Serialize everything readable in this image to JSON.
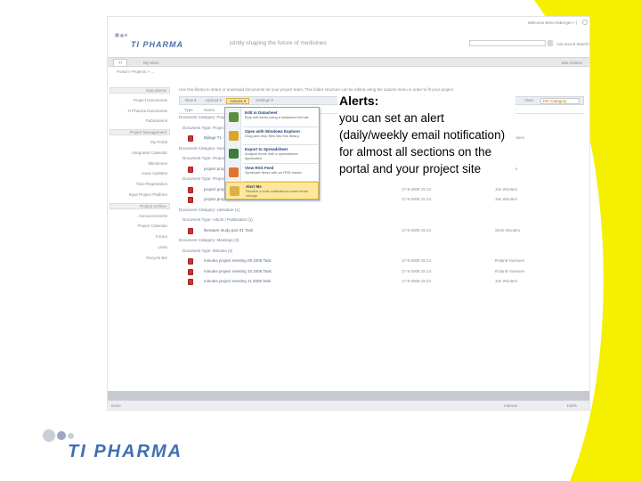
{
  "slide": {
    "callout_title": "Alerts:",
    "callout_body": "you can set an alert (daily/weekly email notification) for almost all sections on the portal and your project site",
    "logo_text": "TI PHARMA",
    "accent_color": "#f5f000",
    "brand_color": "#3f6fb1"
  },
  "screenshot": {
    "welcome": "Welcome Bets Alsbergen • |",
    "logo_text": "TI PHARMA",
    "tagline": "jointly shaping the future of medicines",
    "advanced_search": "Adv anced Search",
    "nav_tab_home": "TI",
    "nav_tab_mysites": "My Sites",
    "site_actions": "Site Actions",
    "breadcrumb": "Portal > Projects > ...",
    "left_nav": [
      {
        "label": "Documents",
        "boxed": true
      },
      {
        "label": "Project Documents",
        "boxed": false
      },
      {
        "label": "TI Pharma Documents",
        "boxed": false
      },
      {
        "label": "Publications",
        "boxed": false
      },
      {
        "label": "Project Management",
        "boxed": true
      },
      {
        "label": "My Portal",
        "boxed": false
      },
      {
        "label": "Integrated Calendar",
        "boxed": false
      },
      {
        "label": "Milestones",
        "boxed": false
      },
      {
        "label": "Issue Updates",
        "boxed": false
      },
      {
        "label": "Time Registration",
        "boxed": false
      },
      {
        "label": "Input Project Platform",
        "boxed": false
      },
      {
        "label": "Project Archive",
        "boxed": true
      },
      {
        "label": "Announcements",
        "boxed": false
      },
      {
        "label": "Project Calendar",
        "boxed": false
      },
      {
        "label": "Forum",
        "boxed": false
      },
      {
        "label": "Links",
        "boxed": false
      },
      {
        "label": "Recycle Bin",
        "boxed": false
      }
    ],
    "description": "Use this library to share or download documents for your project team. This folder structure can be edited using the actions menu in order to fit your project",
    "toolbar": {
      "new": "New ▾",
      "upload": "Upload ▾",
      "actions": "Actions ▾",
      "settings": "Settings ▾",
      "view_label": "View:",
      "view_value": "Per Category"
    },
    "columns": {
      "type": "Type",
      "name": "Name",
      "modified": "Modified",
      "modified_by": "Modified By"
    },
    "rows": [
      {
        "kind": "group",
        "label": "Document Category: Project (1)"
      },
      {
        "kind": "group",
        "label": "Document Type: Project (1)"
      },
      {
        "kind": "doc",
        "name": "Bijlage T1 - TI ...",
        "date": "",
        "who": "Roland Hoessen"
      },
      {
        "kind": "group",
        "label": "Document Category: General (2)"
      },
      {
        "kind": "group",
        "label": "Document Type: Proposal (1)"
      },
      {
        "kind": "doc",
        "name": "project proposal ... 2008 Task",
        "date": "17-9-2008 15:13",
        "who": "Jan Wouters"
      },
      {
        "kind": "group",
        "label": "Document Type: Proposal (1)"
      },
      {
        "kind": "doc",
        "name": "project proposal final doc ... 2008 Task",
        "date": "17-9-2008 15:13",
        "who": "Jan Wouters"
      },
      {
        "kind": "doc",
        "name": "project proposal final draft 2008 Task",
        "date": "17-9-2008 15:13",
        "who": "Jan Wouters"
      },
      {
        "kind": "group",
        "label": "Document Category: Literature (1)"
      },
      {
        "kind": "group",
        "label": "Document Type: Article / Publication (1)"
      },
      {
        "kind": "doc",
        "name": "literature study part 01 Task",
        "date": "17-9-2008 15:13",
        "who": "Stein Wouters"
      },
      {
        "kind": "group",
        "label": "Document Category: Meetings (3)"
      },
      {
        "kind": "group",
        "label": "Document Type: Minutes (3)"
      },
      {
        "kind": "doc",
        "name": "minutes project meeting 09 2008 Task",
        "date": "17-9-2008 15:14",
        "who": "Roland Hoessen"
      },
      {
        "kind": "doc",
        "name": "minutes project meeting 10 2008 Task",
        "date": "17-9-2008 15:14",
        "who": "Roland Hoessen"
      },
      {
        "kind": "doc",
        "name": "minutes project meeting 11 2008 Task",
        "date": "17-9-2008 15:23",
        "who": "Jan Wouters"
      }
    ],
    "actions_menu": [
      {
        "title": "Edit in Datasheet",
        "desc": "Bulk edit items using a datasheet format.",
        "color": "#5b8f3f",
        "highlight": false
      },
      {
        "title": "Open with Windows Explorer",
        "desc": "Drag and drop files into this library.",
        "color": "#d9a629",
        "highlight": false
      },
      {
        "title": "Export to Spreadsheet",
        "desc": "Analyze items with a spreadsheet application.",
        "color": "#3a7c3a",
        "highlight": false
      },
      {
        "title": "View RSS Feed",
        "desc": "Syndicate items with an RSS reader.",
        "color": "#e2742a",
        "highlight": false
      },
      {
        "title": "Alert Me",
        "desc": "Receive e-mail notifications when items change.",
        "color": "#d9b24a",
        "highlight": true
      }
    ],
    "status_left": "Done",
    "status_zone": "Internet",
    "status_zoom": "100%"
  }
}
